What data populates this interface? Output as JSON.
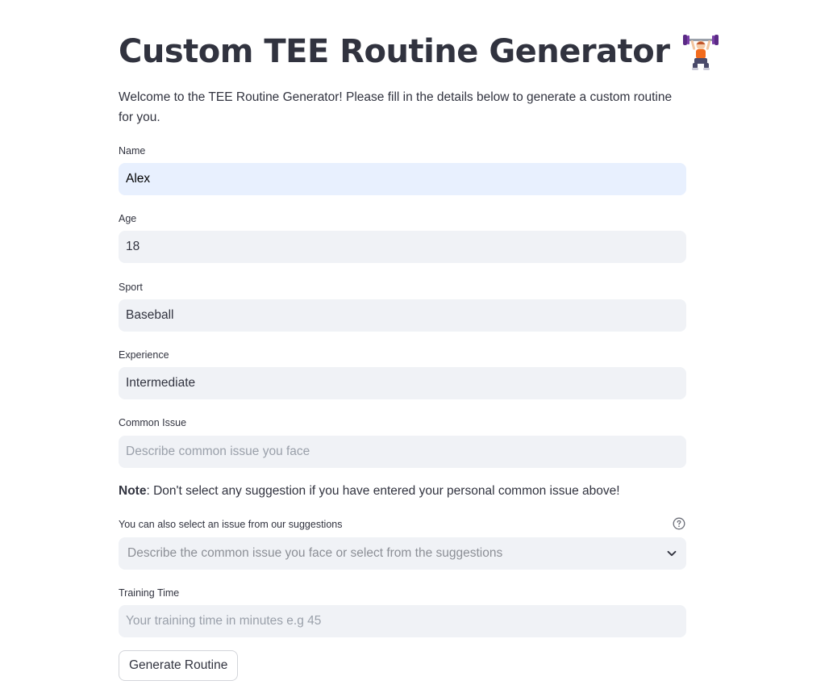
{
  "header": {
    "title": "Custom TEE Routine Generator",
    "title_emoji": "weightlifter-emoji"
  },
  "intro_text": "Welcome to the TEE Routine Generator! Please fill in the details below to generate a custom routine for you.",
  "form": {
    "name": {
      "label": "Name",
      "value": "Alex"
    },
    "age": {
      "label": "Age",
      "value": "18"
    },
    "sport": {
      "label": "Sport",
      "value": "Baseball"
    },
    "experience": {
      "label": "Experience",
      "value": "Intermediate"
    },
    "common_issue": {
      "label": "Common Issue",
      "value": "",
      "placeholder": "Describe common issue you face"
    },
    "note": {
      "bold": "Note",
      "text": ": Don't select any suggestion if you have entered your personal common issue above!"
    },
    "suggestions": {
      "label": "You can also select an issue from our suggestions",
      "placeholder": "Describe the common issue you face or select from the suggestions",
      "help_icon": "question-circle-icon",
      "dropdown_icon": "chevron-down-icon"
    },
    "training_time": {
      "label": "Training Time",
      "value": "",
      "placeholder": "Your training time in minutes e.g 45"
    },
    "submit_label": "Generate Routine"
  },
  "colors": {
    "input_bg": "#f0f2f6",
    "input_active_bg": "#e8f0fe",
    "text": "#31333f",
    "placeholder": "#9aa0aa"
  }
}
